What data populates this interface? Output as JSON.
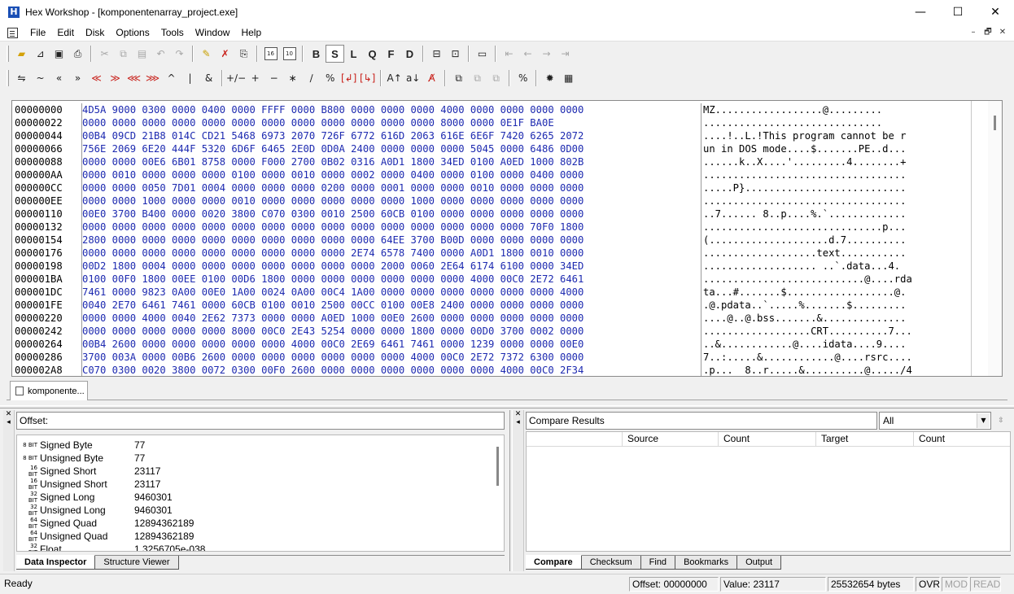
{
  "window": {
    "title": "Hex Workshop - [komponentenarray_project.exe]",
    "app_icon_glyph": "H",
    "minimize": "—",
    "maximize": "☐",
    "close": "✕"
  },
  "menu": {
    "items": [
      "File",
      "Edit",
      "Disk",
      "Options",
      "Tools",
      "Window",
      "Help"
    ],
    "mdi_minimize": "–",
    "mdi_restore": "🗗",
    "mdi_close": "✕"
  },
  "toolbar1": {
    "data_types": [
      "B",
      "S",
      "L",
      "Q",
      "F",
      "D"
    ],
    "box16": "16",
    "box10": "10"
  },
  "toolbar2": {
    "ops": [
      "⇋",
      "~",
      "«",
      "»",
      "≪",
      "≫",
      "⋘",
      "⋙",
      "^",
      "|",
      "&",
      "+∕−",
      "+",
      "−",
      "∗",
      "∕",
      "%"
    ]
  },
  "hex": {
    "offsets": [
      "00000000",
      "00000022",
      "00000044",
      "00000066",
      "00000088",
      "000000AA",
      "000000CC",
      "000000EE",
      "00000110",
      "00000132",
      "00000154",
      "00000176",
      "00000198",
      "000001BA",
      "000001DC",
      "000001FE",
      "00000220",
      "00000242",
      "00000264",
      "00000286",
      "000002A8"
    ],
    "rows": [
      "4D5A 9000 0300 0000 0400 0000 FFFF 0000 B800 0000 0000 0000 4000 0000 0000 0000 0000",
      "0000 0000 0000 0000 0000 0000 0000 0000 0000 0000 0000 0000 8000 0000 0E1F BA0E",
      "00B4 09CD 21B8 014C CD21 5468 6973 2070 726F 6772 616D 2063 616E 6E6F 7420 6265 2072",
      "756E 2069 6E20 444F 5320 6D6F 6465 2E0D 0D0A 2400 0000 0000 0000 5045 0000 6486 0D00",
      "0000 0000 00E6 6B01 8758 0000 F000 2700 0B02 0316 A0D1 1800 34ED 0100 A0ED 1000 802B",
      "0000 0010 0000 0000 0000 0100 0000 0010 0000 0002 0000 0400 0000 0100 0000 0400 0000",
      "0000 0000 0050 7D01 0004 0000 0000 0000 0200 0000 0001 0000 0000 0010 0000 0000 0000",
      "0000 0000 1000 0000 0000 0010 0000 0000 0000 0000 0000 1000 0000 0000 0000 0000 0000",
      "00E0 3700 B400 0000 0020 3800 C070 0300 0010 2500 60CB 0100 0000 0000 0000 0000 0000",
      "0000 0000 0000 0000 0000 0000 0000 0000 0000 0000 0000 0000 0000 0000 0000 70F0 1800",
      "2800 0000 0000 0000 0000 0000 0000 0000 0000 0000 64EE 3700 B00D 0000 0000 0000 0000",
      "0000 0000 0000 0000 0000 0000 0000 0000 0000 2E74 6578 7400 0000 A0D1 1800 0010 0000",
      "00D2 1800 0004 0000 0000 0000 0000 0000 0000 0000 2000 0060 2E64 6174 6100 0000 34ED",
      "0100 00F0 1800 00EE 0100 00D6 1800 0000 0000 0000 0000 0000 0000 4000 00C0 2E72 6461",
      "7461 0000 9823 0A00 00E0 1A00 0024 0A00 00C4 1A00 0000 0000 0000 0000 0000 0000 4000",
      "0040 2E70 6461 7461 0000 60CB 0100 0010 2500 00CC 0100 00E8 2400 0000 0000 0000 0000",
      "0000 0000 4000 0040 2E62 7373 0000 0000 A0ED 1000 00E0 2600 0000 0000 0000 0000 0000",
      "0000 0000 0000 0000 0000 8000 00C0 2E43 5254 0000 0000 1800 0000 00D0 3700 0002 0000",
      "00B4 2600 0000 0000 0000 0000 0000 4000 00C0 2E69 6461 7461 0000 1239 0000 0000 00E0",
      "3700 003A 0000 00B6 2600 0000 0000 0000 0000 0000 0000 4000 00C0 2E72 7372 6300 0000",
      "C070 0300 0020 3800 0072 0300 00F0 2600 0000 0000 0000 0000 0000 0000 4000 00C0 2F34"
    ],
    "ascii": [
      "MZ..................@.........",
      "..............................",
      "....!..L.!This program cannot be r",
      "un in DOS mode....$.......PE..d...",
      "......k..X....'.........4........+",
      "..................................",
      ".....P}...........................",
      "..................................",
      "..7...... 8..p....%.`.............",
      "..............................p...",
      "(....................d.7..........",
      "...................text...........",
      "................... ..`.data...4.",
      "...........................@....rda",
      "ta...#.......$..................@.",
      ".@.pdata..`.....%.......$.........",
      "....@..@.bss.......&..............",
      "..................CRT..........7...",
      "..&............@....idata....9....",
      "7..:.....&............@....rsrc....",
      ".p...  8..r.....&..........@...../4"
    ]
  },
  "doc_tab": {
    "label": "komponente..."
  },
  "inspector": {
    "offset_label": "Offset:",
    "rows": [
      {
        "bits": "8 BIT",
        "label": "Signed Byte",
        "value": "77"
      },
      {
        "bits": "8 BIT",
        "label": "Unsigned Byte",
        "value": "77"
      },
      {
        "bits": "16 BIT",
        "label": "Signed Short",
        "value": "23117"
      },
      {
        "bits": "16 BIT",
        "label": "Unsigned Short",
        "value": "23117"
      },
      {
        "bits": "32 BIT",
        "label": "Signed Long",
        "value": "9460301"
      },
      {
        "bits": "32 BIT",
        "label": "Unsigned Long",
        "value": "9460301"
      },
      {
        "bits": "64 BIT",
        "label": "Signed Quad",
        "value": "12894362189"
      },
      {
        "bits": "64 BIT",
        "label": "Unsigned Quad",
        "value": "12894362189"
      },
      {
        "bits": "32 BIT",
        "label": "Float",
        "value": "1.3256705e-038"
      }
    ],
    "tabs": [
      "Data Inspector",
      "Structure Viewer"
    ]
  },
  "compare": {
    "title": "Compare Results",
    "filter": "All",
    "columns": [
      "",
      "Source",
      "Count",
      "Target",
      "Count"
    ],
    "tabs": [
      "Compare",
      "Checksum",
      "Find",
      "Bookmarks",
      "Output"
    ]
  },
  "status": {
    "ready": "Ready",
    "offset": "Offset: 00000000",
    "value": "Value: 23117",
    "size": "25532654 bytes",
    "ovr": "OVR",
    "mod": "MOD",
    "read": "READ"
  }
}
